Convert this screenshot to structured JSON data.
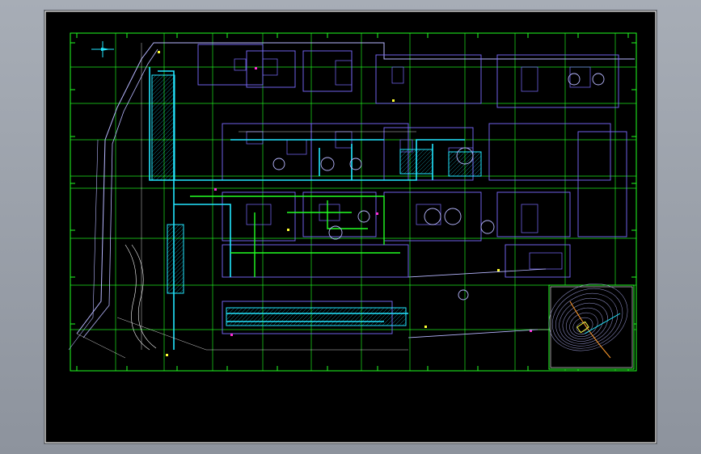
{
  "window": {
    "background": "#9aa0aa",
    "canvas_background": "#000000"
  },
  "drawing": {
    "colors": {
      "frame": "#ffffff",
      "grid": "#22ff22",
      "building": "#7b6bff",
      "pipe": "#22e6ff",
      "dim": "#ffffff",
      "accent": "#ff2bd6",
      "highlight": "#ffff33",
      "road": "#b7b7ff"
    },
    "grid_label": "0"
  },
  "inset_map": {
    "description_label": ""
  }
}
